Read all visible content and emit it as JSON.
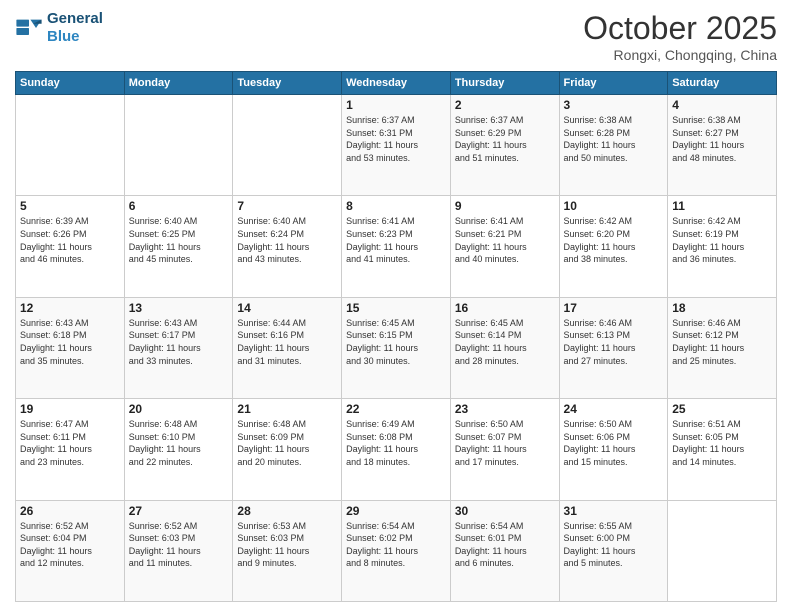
{
  "header": {
    "logo_line1": "General",
    "logo_line2": "Blue",
    "month": "October 2025",
    "location": "Rongxi, Chongqing, China"
  },
  "weekdays": [
    "Sunday",
    "Monday",
    "Tuesday",
    "Wednesday",
    "Thursday",
    "Friday",
    "Saturday"
  ],
  "weeks": [
    [
      {
        "day": "",
        "info": ""
      },
      {
        "day": "",
        "info": ""
      },
      {
        "day": "",
        "info": ""
      },
      {
        "day": "1",
        "info": "Sunrise: 6:37 AM\nSunset: 6:31 PM\nDaylight: 11 hours\nand 53 minutes."
      },
      {
        "day": "2",
        "info": "Sunrise: 6:37 AM\nSunset: 6:29 PM\nDaylight: 11 hours\nand 51 minutes."
      },
      {
        "day": "3",
        "info": "Sunrise: 6:38 AM\nSunset: 6:28 PM\nDaylight: 11 hours\nand 50 minutes."
      },
      {
        "day": "4",
        "info": "Sunrise: 6:38 AM\nSunset: 6:27 PM\nDaylight: 11 hours\nand 48 minutes."
      }
    ],
    [
      {
        "day": "5",
        "info": "Sunrise: 6:39 AM\nSunset: 6:26 PM\nDaylight: 11 hours\nand 46 minutes."
      },
      {
        "day": "6",
        "info": "Sunrise: 6:40 AM\nSunset: 6:25 PM\nDaylight: 11 hours\nand 45 minutes."
      },
      {
        "day": "7",
        "info": "Sunrise: 6:40 AM\nSunset: 6:24 PM\nDaylight: 11 hours\nand 43 minutes."
      },
      {
        "day": "8",
        "info": "Sunrise: 6:41 AM\nSunset: 6:23 PM\nDaylight: 11 hours\nand 41 minutes."
      },
      {
        "day": "9",
        "info": "Sunrise: 6:41 AM\nSunset: 6:21 PM\nDaylight: 11 hours\nand 40 minutes."
      },
      {
        "day": "10",
        "info": "Sunrise: 6:42 AM\nSunset: 6:20 PM\nDaylight: 11 hours\nand 38 minutes."
      },
      {
        "day": "11",
        "info": "Sunrise: 6:42 AM\nSunset: 6:19 PM\nDaylight: 11 hours\nand 36 minutes."
      }
    ],
    [
      {
        "day": "12",
        "info": "Sunrise: 6:43 AM\nSunset: 6:18 PM\nDaylight: 11 hours\nand 35 minutes."
      },
      {
        "day": "13",
        "info": "Sunrise: 6:43 AM\nSunset: 6:17 PM\nDaylight: 11 hours\nand 33 minutes."
      },
      {
        "day": "14",
        "info": "Sunrise: 6:44 AM\nSunset: 6:16 PM\nDaylight: 11 hours\nand 31 minutes."
      },
      {
        "day": "15",
        "info": "Sunrise: 6:45 AM\nSunset: 6:15 PM\nDaylight: 11 hours\nand 30 minutes."
      },
      {
        "day": "16",
        "info": "Sunrise: 6:45 AM\nSunset: 6:14 PM\nDaylight: 11 hours\nand 28 minutes."
      },
      {
        "day": "17",
        "info": "Sunrise: 6:46 AM\nSunset: 6:13 PM\nDaylight: 11 hours\nand 27 minutes."
      },
      {
        "day": "18",
        "info": "Sunrise: 6:46 AM\nSunset: 6:12 PM\nDaylight: 11 hours\nand 25 minutes."
      }
    ],
    [
      {
        "day": "19",
        "info": "Sunrise: 6:47 AM\nSunset: 6:11 PM\nDaylight: 11 hours\nand 23 minutes."
      },
      {
        "day": "20",
        "info": "Sunrise: 6:48 AM\nSunset: 6:10 PM\nDaylight: 11 hours\nand 22 minutes."
      },
      {
        "day": "21",
        "info": "Sunrise: 6:48 AM\nSunset: 6:09 PM\nDaylight: 11 hours\nand 20 minutes."
      },
      {
        "day": "22",
        "info": "Sunrise: 6:49 AM\nSunset: 6:08 PM\nDaylight: 11 hours\nand 18 minutes."
      },
      {
        "day": "23",
        "info": "Sunrise: 6:50 AM\nSunset: 6:07 PM\nDaylight: 11 hours\nand 17 minutes."
      },
      {
        "day": "24",
        "info": "Sunrise: 6:50 AM\nSunset: 6:06 PM\nDaylight: 11 hours\nand 15 minutes."
      },
      {
        "day": "25",
        "info": "Sunrise: 6:51 AM\nSunset: 6:05 PM\nDaylight: 11 hours\nand 14 minutes."
      }
    ],
    [
      {
        "day": "26",
        "info": "Sunrise: 6:52 AM\nSunset: 6:04 PM\nDaylight: 11 hours\nand 12 minutes."
      },
      {
        "day": "27",
        "info": "Sunrise: 6:52 AM\nSunset: 6:03 PM\nDaylight: 11 hours\nand 11 minutes."
      },
      {
        "day": "28",
        "info": "Sunrise: 6:53 AM\nSunset: 6:03 PM\nDaylight: 11 hours\nand 9 minutes."
      },
      {
        "day": "29",
        "info": "Sunrise: 6:54 AM\nSunset: 6:02 PM\nDaylight: 11 hours\nand 8 minutes."
      },
      {
        "day": "30",
        "info": "Sunrise: 6:54 AM\nSunset: 6:01 PM\nDaylight: 11 hours\nand 6 minutes."
      },
      {
        "day": "31",
        "info": "Sunrise: 6:55 AM\nSunset: 6:00 PM\nDaylight: 11 hours\nand 5 minutes."
      },
      {
        "day": "",
        "info": ""
      }
    ]
  ]
}
